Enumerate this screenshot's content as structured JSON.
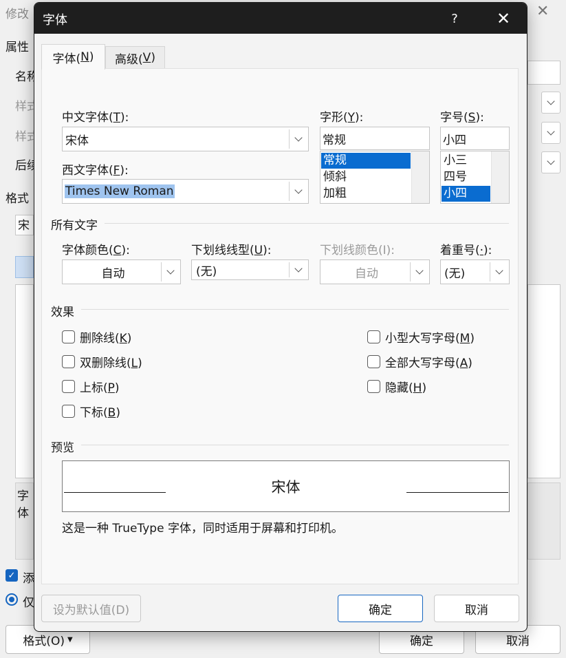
{
  "background_dialog": {
    "title": "修改",
    "close_glyph": "✕",
    "labels": {
      "properties": "属性",
      "name": "名称",
      "style_type": "样式",
      "style_base": "样式",
      "follow": "后续",
      "format": "格式"
    },
    "format_font_partial": "宋",
    "desc_partial": "字体",
    "add_checkbox_partial": "添",
    "only_radio_partial": "仅",
    "format_button": "格式(O)",
    "ok_button": "确定",
    "cancel_button": "取消"
  },
  "dialog": {
    "title": "字体",
    "help_glyph": "?",
    "close_glyph": "✕",
    "tabs": [
      {
        "label": "字体(",
        "key": "N",
        "suffix": ")"
      },
      {
        "label": "高级(",
        "key": "V",
        "suffix": ")"
      }
    ],
    "chinese_font": {
      "label": "中文字体(",
      "key": "T",
      "suffix": "):",
      "value": "宋体"
    },
    "western_font": {
      "label": "西文字体(",
      "key": "F",
      "suffix": "):",
      "value": "Times New Roman"
    },
    "style": {
      "label": "字形(",
      "key": "Y",
      "suffix": "):",
      "value": "常规",
      "options": [
        "常规",
        "倾斜",
        "加粗"
      ],
      "selected": "常规"
    },
    "size": {
      "label": "字号(",
      "key": "S",
      "suffix": "):",
      "value": "小四",
      "options": [
        "小三",
        "四号",
        "小四"
      ],
      "selected": "小四"
    },
    "all_text": {
      "heading": "所有文字",
      "font_color": {
        "label": "字体颜色(",
        "key": "C",
        "suffix": "):",
        "value": "自动"
      },
      "underline_style": {
        "label": "下划线线型(",
        "key": "U",
        "suffix": "):",
        "value": "(无)"
      },
      "underline_color": {
        "label": "下划线颜色(I):",
        "value": "自动"
      },
      "emphasis": {
        "label": "着重号(",
        "key": "·",
        "suffix": "):",
        "value": "(无)"
      }
    },
    "effects": {
      "heading": "效果",
      "left": [
        {
          "label": "删除线(",
          "key": "K",
          "suffix": ")"
        },
        {
          "label": "双删除线(",
          "key": "L",
          "suffix": ")"
        },
        {
          "label": "上标(",
          "key": "P",
          "suffix": ")"
        },
        {
          "label": "下标(",
          "key": "B",
          "suffix": ")"
        }
      ],
      "right": [
        {
          "label": "小型大写字母(",
          "key": "M",
          "suffix": ")"
        },
        {
          "label": "全部大写字母(",
          "key": "A",
          "suffix": ")"
        },
        {
          "label": "隐藏(",
          "key": "H",
          "suffix": ")"
        }
      ]
    },
    "preview": {
      "heading": "预览",
      "sample": "宋体",
      "description": "这是一种 TrueType 字体，同时适用于屏幕和打印机。"
    },
    "buttons": {
      "set_default": "设为默认值(D)",
      "ok": "确定",
      "cancel": "取消"
    }
  },
  "colors": {
    "titlebar": "#1e1e1e",
    "selection": "#0a6cd0",
    "text_highlight": "#9fc4ef",
    "primary_border": "#1565c0"
  }
}
